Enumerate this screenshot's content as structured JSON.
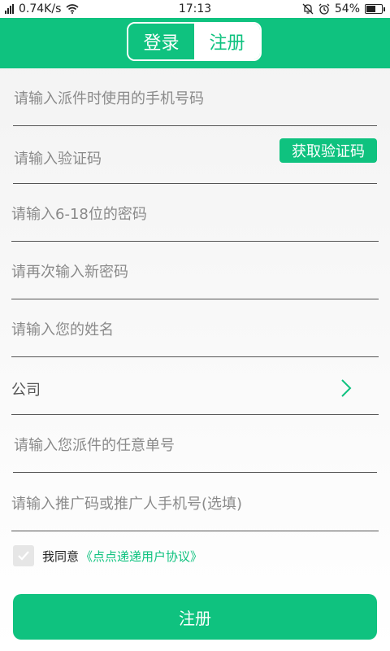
{
  "status_bar": {
    "network_speed": "0.74K/s",
    "time": "17:13",
    "battery": "54%",
    "battery_level": 0.54
  },
  "header": {
    "login_tab": "登录",
    "register_tab": "注册",
    "active_tab": "注册"
  },
  "form": {
    "phone_placeholder": "请输入派件时使用的手机号码",
    "code_placeholder": "请输入验证码",
    "get_code_label": "获取验证码",
    "password_placeholder": "请输入6-18位的密码",
    "confirm_password_placeholder": "请再次输入新密码",
    "name_placeholder": "请输入您的姓名",
    "company_label": "公司",
    "tracking_placeholder": "请输入您派件的任意单号",
    "referral_placeholder": "请输入推广码或推广人手机号(选填)"
  },
  "agreement": {
    "checked": true,
    "prefix": "我同意",
    "link_text": "《点点递递用户协议》"
  },
  "submit_label": "注册",
  "colors": {
    "accent": "#0fc27f"
  }
}
